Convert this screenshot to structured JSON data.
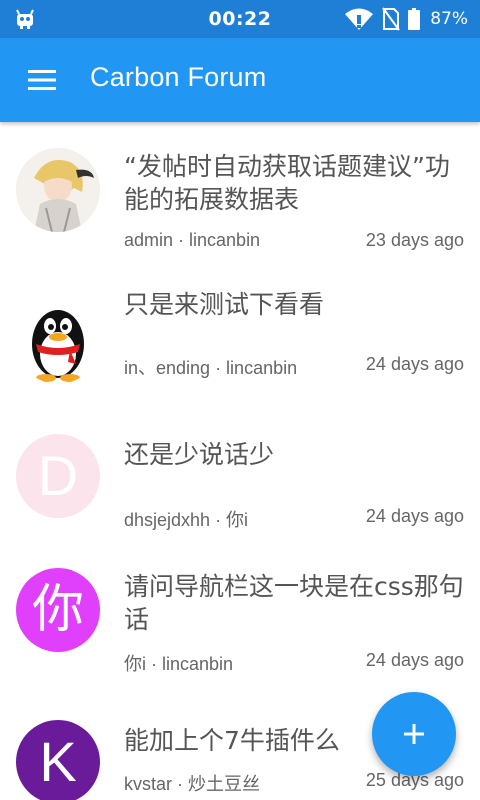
{
  "status_bar": {
    "time": "00:22",
    "battery": "87%",
    "icons": [
      "robot-icon",
      "wifi-icon",
      "no-sim-icon",
      "battery-icon"
    ]
  },
  "app_bar": {
    "title": "Carbon Forum",
    "menu_icon": "hamburger-menu-icon"
  },
  "topics": [
    {
      "title": "“发帖时自动获取话题建议”功能的拓展数据表",
      "meta": "admin · lincanbin",
      "time": "23 days ago",
      "avatar": "anime-character"
    },
    {
      "title": "只是来测试下看看",
      "meta": "in、ending · lincanbin",
      "time": "24 days ago",
      "avatar": "penguin"
    },
    {
      "title": "还是少说话少",
      "meta": "dhsjejdxhh · 你i",
      "time": "24 days ago",
      "avatar_letter": "D",
      "avatar_color": "#fce4ec"
    },
    {
      "title": "请问导航栏这一块是在css那句话",
      "meta": "你i · lincanbin",
      "time": "24 days ago",
      "avatar_letter": "你",
      "avatar_color": "#e040fb"
    },
    {
      "title": "能加上个7牛插件么",
      "meta": "kvstar · 炒土豆丝",
      "time": "25 days ago",
      "avatar_letter": "K",
      "avatar_color": "#6a1b9a"
    }
  ],
  "fab": {
    "label": "+",
    "icon": "plus-icon"
  },
  "colors": {
    "primary": "#2196f3",
    "status_bar": "#1f7fd6"
  }
}
